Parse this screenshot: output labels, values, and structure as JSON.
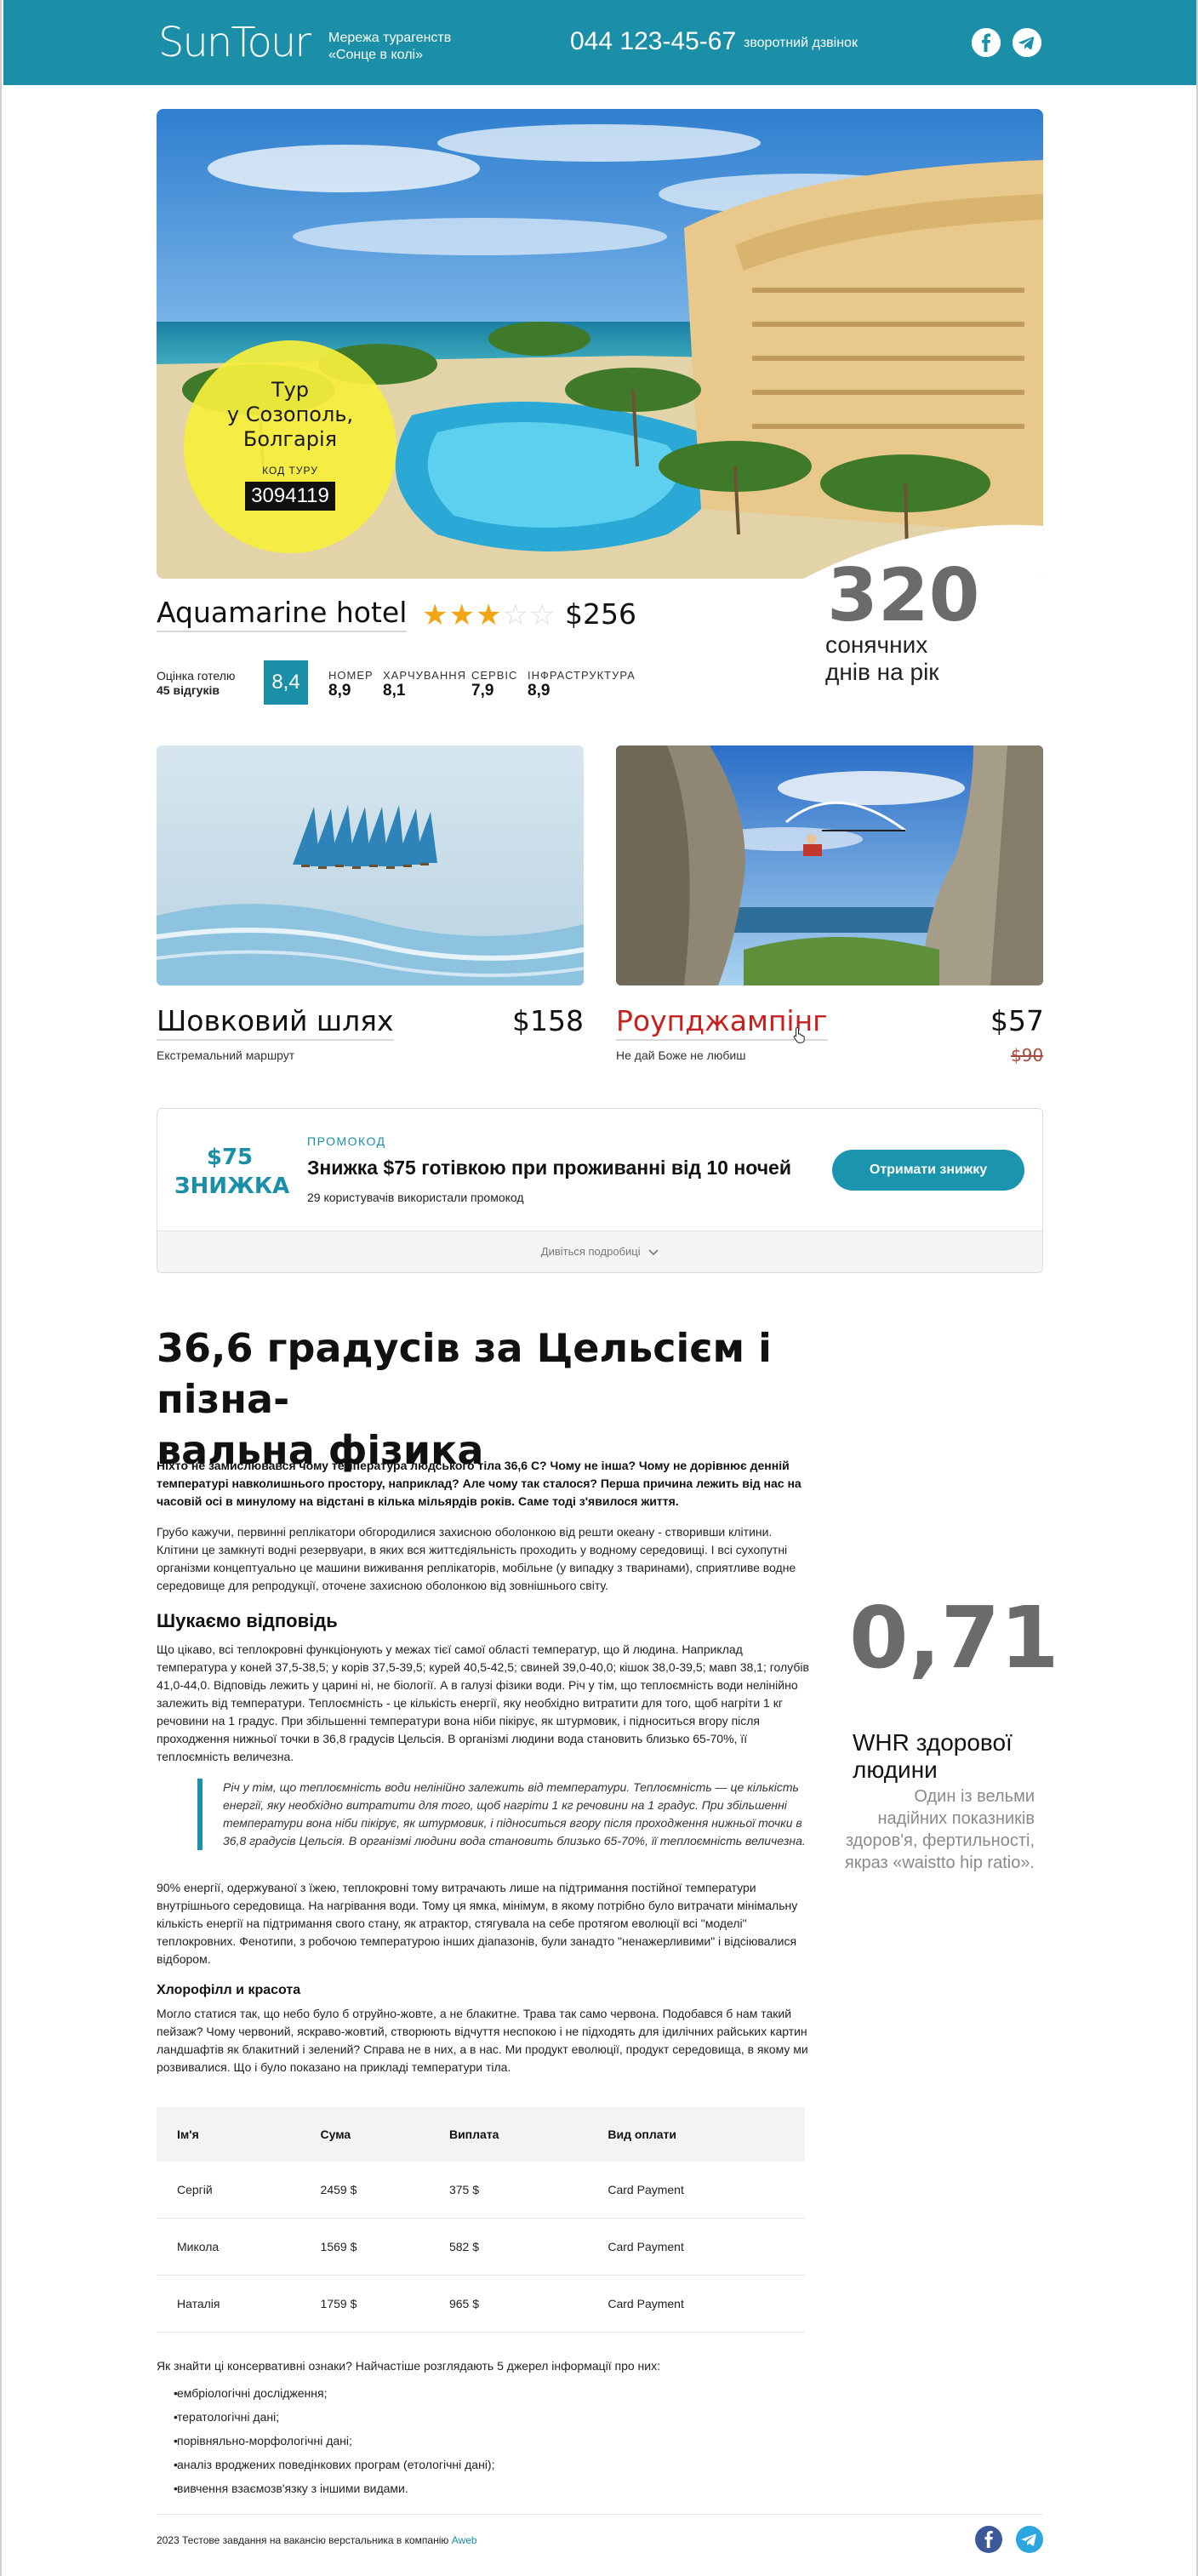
{
  "header": {
    "logo": "SunTour",
    "tagline_line1": "Мережа турагенств",
    "tagline_line2": "«Сонце в колі»",
    "phone": "044 123-45-67",
    "callback": "зворотний дзвінок"
  },
  "tour": {
    "title_line1": "Тур",
    "title_line2": "у Созополь,",
    "title_line3": "Болгарія",
    "code_label": "КОД ТУРУ",
    "code": "3094119"
  },
  "hotel": {
    "name": "Aquamarine hotel",
    "stars": 3,
    "max_stars": 5,
    "price": "$256",
    "rating_label": "Оцінка готелю",
    "reviews": "45 відгуків",
    "score": "8,4",
    "subscores": [
      {
        "label": "НОМЕР",
        "value": "8,9"
      },
      {
        "label": "ХАРЧУВАННЯ",
        "value": "8,1"
      },
      {
        "label": "СЕРВІС",
        "value": "7,9"
      },
      {
        "label": "ІНФРАСТРУКТУРА",
        "value": "8,9"
      }
    ]
  },
  "sunny": {
    "number": "320",
    "line1": "сонячних",
    "line2": "днів на рік"
  },
  "cards": [
    {
      "title": "Шовковий шлях",
      "price": "$158",
      "subtitle": "Екстремальний маршрут",
      "old_price": ""
    },
    {
      "title": "Роупджампінг",
      "price": "$57",
      "subtitle": "Не дай Боже не любиш",
      "old_price": "$90"
    }
  ],
  "promo": {
    "amount": "$75",
    "amount_word": "ЗНИЖКА",
    "label": "ПРОМОКОД",
    "title": "Знижка $75 готівкою при проживанні від 10 ночей",
    "subtitle": "29 користувачів використали промокод",
    "button": "Отримати знижку",
    "details": "Дивіться подробиці"
  },
  "article": {
    "title_line1": "36,6 градусів за Цельсієм і пізна-",
    "title_line2": "вальна фізика",
    "lead": "Ніхто не замислювався чому температура людського тіла 36,6 С? Чому не інша? Чому не дорівнює денній температурі навколишнього простору, наприклад? Але чому так сталося? Перша причина лежить від нас на часовій осі в минулому на відстані в кілька мільярдів років. Саме тоді з'явилося життя.",
    "p1": "Грубо кажучи, первинні реплікатори обгородилися захисною оболонкою від решти океану - створивши клітини. Клітини це замкнуті водні резервуари, в яких вся життєдіяльність проходить у водному середовищі. І всі сухопутні організми концептуально це машини виживання реплікаторів, мобільне (у випадку з тваринами), сприятливе водне середовище для репродукції, оточене захисною оболонкою від зовнішнього світу.",
    "h2": "Шукаємо відповідь",
    "p2": "Що цікаво, всі теплокровні функціонують у межах тієї самої області температур, що й людина. Наприклад температура у коней 37,5-38,5; у корів 37,5-39,5; курей 40,5-42,5; свиней 39,0-40,0; кішок 38,0-39,5; мавп 38,1; голубів 41,0-44,0. Відповідь лежить у царині ні, не біології. А в галузі фізики води. Річ у тім, що теплоємність води нелінійно залежить від температури. Теплоємність - це кількість енергії, яку необхідно витратити для того, щоб нагріти 1 кг речовини на 1 градус. При збільшенні температури вона ніби пікірує, як штурмовик, і підноситься вгору після проходження нижньої точки в 36,8 градусів Цельсія. В організмі людини вода становить близько 65-70%, її теплоємність величезна.",
    "quote": "Річ у тім, що теплоємність води нелінійно залежить від температури. Теплоємність — це кількість енергії, яку необхідно витратити для того, щоб нагріти 1 кг речовини на 1 градус. При збільшенні температури вона ніби пікірує, як штурмовик, і підноситься вгору після проходження нижньої точки в 36,8 градусів Цельсія. В організмі людини вода становить близько 65-70%, її теплоємність величезна.",
    "p3": "90% енергії, одержуваної з їжею, теплокровні тому витрачають лише на підтримання постійної температури внутрішнього середовища. На нагрівання води. Тому ця ямка, мінімум, в якому потрібно було витрачати мінімальну кількість енергії на підтримання свого стану, як атрактор, стягувала на себе протягом еволюції всі \"моделі\" теплокровних. Фенотипи, з робочою температурою інших діапазонів, були занадто \"ненажерливими\" і відсіювалися відбором.",
    "h3": "Хлорофілл и красота",
    "p4": "Могло статися так, що небо було б отруйно-жовте, а не блакитне. Трава так само червона. Подобався б нам такий пейзаж? Чому червоний, яскраво-жовтий, створюють відчуття неспокою і не підходять для ідилічних райських картин ландшафтів як блакитний і зелений? Справа не в них, а в нас. Ми продукт еволюції, продукт середовища, в якому ми розвивалися. Що і було показано на прикладі температури тіла.",
    "list_intro": "Як знайти ці консервативні ознаки? Найчастіше розглядають 5 джерел інформації про них:",
    "list": [
      "ембріологічні дослідження;",
      "тератологічні дані;",
      "порівняльно-морфологічні дані;",
      "аналіз вроджених поведінкових програм (етологічні дані);",
      "вивчення взаємозв'язку з іншими видами."
    ]
  },
  "side": {
    "number": "0,71",
    "title": "WHR здорової людини",
    "text": "Один із вельми надійних показників здоров'я, фертильності, якраз «waistto hip ratio»."
  },
  "table": {
    "headers": [
      "Ім'я",
      "Сума",
      "Виплата",
      "Вид оплати"
    ],
    "rows": [
      [
        "Сергій",
        "2459 $",
        "375 $",
        "Card Payment"
      ],
      [
        "Микола",
        "1569 $",
        "582 $",
        "Card Payment"
      ],
      [
        "Наталія",
        "1759 $",
        "965 $",
        "Card Payment"
      ]
    ]
  },
  "footer": {
    "text": "2023 Тестове завдання на вакансію верстальника в компанію",
    "link": "Aweb"
  },
  "colors": {
    "brand": "#1a8fa7",
    "badge": "#f6ee3c",
    "star": "#f2a515",
    "highlight_red": "#c8201e",
    "facebook": "#3b5998",
    "telegram": "#2ca5e0"
  }
}
